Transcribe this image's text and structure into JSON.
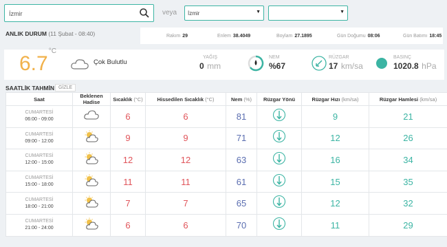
{
  "search": {
    "value": "İzmir",
    "veya": "veya"
  },
  "selects": {
    "province": "İzmir",
    "district": ""
  },
  "anlik": {
    "label": "ANLIK DURUM",
    "date": "(11 Şubat - 08:40)"
  },
  "info": {
    "rakim_label": "Rakım",
    "rakim": "29",
    "enlem_label": "Enlem",
    "enlem": "38.4049",
    "boylam_label": "Boylam",
    "boylam": "27.1895",
    "dogum_label": "Gün Doğumu",
    "dogum": "08:06",
    "batim_label": "Gün Batımı",
    "batim": "18:45"
  },
  "current": {
    "temp": "6.7",
    "temp_unit": "°C",
    "condition": "Çok Bulutlu",
    "yagis_label": "YAĞIŞ",
    "yagis": "0",
    "yagis_unit": "mm",
    "nem_label": "NEM",
    "nem": "%67",
    "ruzgar_label": "RÜZGAR",
    "ruzgar": "17",
    "ruzgar_unit": "km/sa",
    "basinc_label": "BASINÇ",
    "basinc": "1020.8",
    "basinc_unit": "hPa"
  },
  "saatlik": {
    "label": "SAATLİK TAHMİN",
    "gizle": "GİZLE"
  },
  "table": {
    "headers": {
      "saat": "Saat",
      "hadise1": "Beklenen",
      "hadise2": "Hadise",
      "sicaklik": "Sıcaklık",
      "sicaklik_u": "(°C)",
      "hissedilen": "Hissedilen Sıcaklık",
      "hissedilen_u": "(°C)",
      "nem": "Nem",
      "nem_u": "(%)",
      "yon": "Rüzgar Yönü",
      "hiz": "Rüzgar Hızı",
      "hiz_u": "(km/sa)",
      "hamle": "Rüzgar Hamlesi",
      "hamle_u": "(km/sa)"
    },
    "rows": [
      {
        "day": "CUMARTESİ",
        "time": "06:00 - 09:00",
        "icon": "cloud-icon",
        "temp": "6",
        "feel": "6",
        "nem": "81",
        "hiz": "9",
        "hamle": "21"
      },
      {
        "day": "CUMARTESİ",
        "time": "09:00 - 12:00",
        "icon": "partly-cloudy-icon",
        "temp": "9",
        "feel": "9",
        "nem": "71",
        "hiz": "12",
        "hamle": "26"
      },
      {
        "day": "CUMARTESİ",
        "time": "12:00 - 15:00",
        "icon": "partly-cloudy-icon",
        "temp": "12",
        "feel": "12",
        "nem": "63",
        "hiz": "16",
        "hamle": "34"
      },
      {
        "day": "CUMARTESİ",
        "time": "15:00 - 18:00",
        "icon": "partly-cloudy-icon",
        "temp": "11",
        "feel": "11",
        "nem": "61",
        "hiz": "15",
        "hamle": "35"
      },
      {
        "day": "CUMARTESİ",
        "time": "18:00 - 21:00",
        "icon": "partly-cloudy-icon",
        "temp": "7",
        "feel": "7",
        "nem": "65",
        "hiz": "12",
        "hamle": "32"
      },
      {
        "day": "CUMARTESİ",
        "time": "21:00 - 24:00",
        "icon": "partly-cloudy-icon",
        "temp": "6",
        "feel": "6",
        "nem": "70",
        "hiz": "11",
        "hamle": "29"
      }
    ]
  },
  "colors": {
    "accent": "#3bb4a3",
    "temp": "#f1b14a",
    "red": "#e0545a",
    "blue": "#5a6db0"
  }
}
